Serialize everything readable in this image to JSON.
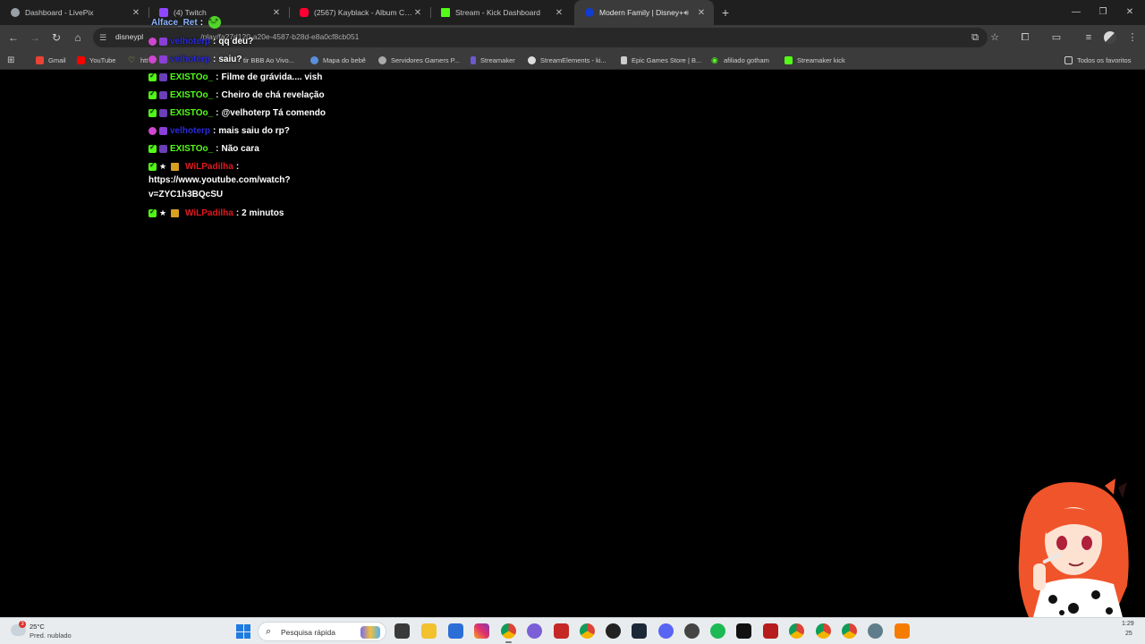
{
  "tabs": [
    {
      "title": "Dashboard - LivePix",
      "color": "#9aa0a6",
      "active": false
    },
    {
      "title": "(4) Twitch",
      "color": "#9146ff",
      "active": false
    },
    {
      "title": "(2567) Kayblack - Album Comp",
      "color": "#ff0033",
      "active": false
    },
    {
      "title": "Stream - Kick Dashboard",
      "color": "#53fc18",
      "active": false
    },
    {
      "title": "Modern Family | Disney+",
      "color": "#113ccf",
      "active": true
    }
  ],
  "toolbar": {
    "url": "disneypl",
    "url_tail": "/play/fa27d120-a20e-4587-b28d-e8a0cf8cb051"
  },
  "bookmarks": {
    "items": [
      {
        "label": "Gmail",
        "color": "#ea4335"
      },
      {
        "label": "YouTube",
        "color": "#ff0000"
      },
      {
        "label": "htt",
        "color": "#a0c040"
      },
      {
        "label": "tir BBB Ao Vivo...",
        "color": "#666666"
      },
      {
        "label": "Mapa do bebê",
        "color": "#5b8fd9"
      },
      {
        "label": "Servidores Gamers P...",
        "color": "#aaaaaa"
      },
      {
        "label": "Streamaker",
        "color": "#6a5acd"
      },
      {
        "label": "StreamElements - ki...",
        "color": "#dddddd"
      },
      {
        "label": "Epic Games Store | B...",
        "color": "#cccccc"
      },
      {
        "label": "afiliado gotham",
        "color": "#53fc18"
      },
      {
        "label": "Streamaker kick",
        "color": "#53fc18"
      }
    ],
    "all_label": "Todos os favoritos"
  },
  "chat": {
    "messages": [
      {
        "user": "Alface_Ret",
        "sep": ":",
        "text": ""
      },
      {
        "user": "velhoterp",
        "sep": ":",
        "text": "qq deu?"
      },
      {
        "user": "velhoterp",
        "sep": ":",
        "text": "saiu?"
      },
      {
        "user": "EXISTOo_",
        "sep": ":",
        "text": "Filme de grávida.... vish"
      },
      {
        "user": "EXISTOo_",
        "sep": ":",
        "text": "Cheiro de chá revelação"
      },
      {
        "user": "EXISTOo_",
        "sep": ":",
        "text": "@velhoterp Tá comendo"
      },
      {
        "user": "velhoterp",
        "sep": ":",
        "text": "mais saiu do rp?"
      },
      {
        "user": "EXISTOo_",
        "sep": ":",
        "text": "Não cara"
      },
      {
        "user": "WiLPadilha",
        "sep": ":",
        "text": ""
      },
      {
        "user": "WiLPadilha",
        "sep": ":",
        "text": "2 minutos"
      }
    ],
    "link_line1": "https://www.youtube.com/watch?",
    "link_line2": "v=ZYC1h3BQcSU",
    "colors": {
      "green": "#53fc18",
      "blue": "#2a2ad8",
      "red": "#e0191f"
    }
  },
  "taskbar": {
    "temperature": "25°C",
    "weather": "Pred. nublado",
    "weather_badge": "3",
    "search_placeholder": "Pesquisa rápida",
    "clock_time": "1:29",
    "clock_date": "25"
  }
}
